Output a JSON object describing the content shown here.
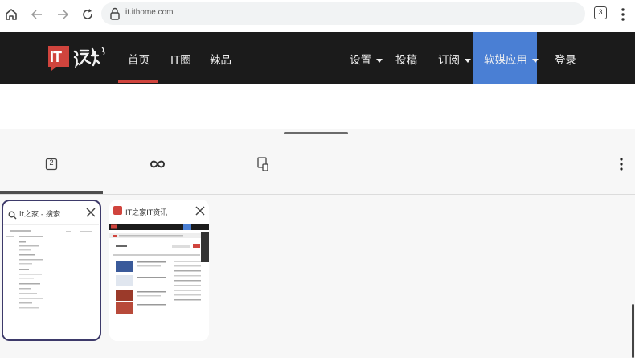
{
  "browser": {
    "url": "it.ithome.com",
    "tab_count": "3"
  },
  "site": {
    "logo_text": "IT",
    "nav": [
      {
        "label": "首页",
        "active": true
      },
      {
        "label": "IT圈"
      },
      {
        "label": "辣品"
      }
    ],
    "right_nav": [
      {
        "label": "设置",
        "dropdown": true
      },
      {
        "label": "投稿"
      },
      {
        "label": "订阅",
        "dropdown": true
      },
      {
        "label": "软媒应用",
        "dropdown": true,
        "highlighted": true
      },
      {
        "label": "登录"
      }
    ],
    "colors": {
      "header_bg": "#1b1b1b",
      "accent_red": "#d0443d",
      "highlight_blue": "#4a7fd4"
    }
  },
  "tab_switcher": {
    "group_tabs": [
      {
        "icon": "tab-count-icon",
        "count": "2"
      },
      {
        "icon": "infinity-icon"
      },
      {
        "icon": "device-tab-icon"
      }
    ],
    "cards": [
      {
        "title": "it之家 - 搜索",
        "icon": "search-icon",
        "selected": true
      },
      {
        "title": "IT之家IT资讯",
        "icon": "ithome-favicon",
        "selected": false
      }
    ]
  }
}
